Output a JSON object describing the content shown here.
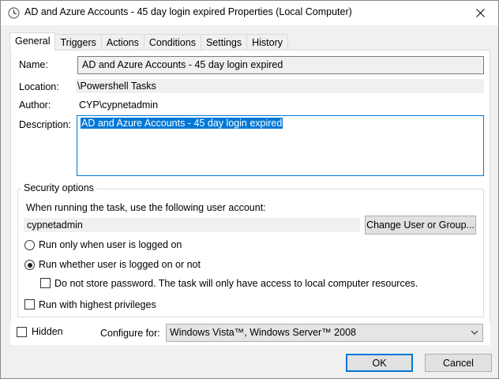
{
  "window": {
    "title": "AD and Azure Accounts - 45 day login expired Properties (Local Computer)"
  },
  "tabs": [
    {
      "label": "General"
    },
    {
      "label": "Triggers"
    },
    {
      "label": "Actions"
    },
    {
      "label": "Conditions"
    },
    {
      "label": "Settings"
    },
    {
      "label": "History"
    }
  ],
  "general": {
    "name_label": "Name:",
    "name_value": "AD and Azure Accounts - 45 day login expired",
    "location_label": "Location:",
    "location_value": "\\Powershell Tasks",
    "author_label": "Author:",
    "author_value": "CYP\\cypnetadmin",
    "description_label": "Description:",
    "description_value": "AD and Azure Accounts - 45 day login expired"
  },
  "security": {
    "group_title": "Security options",
    "account_prompt": "When running the task, use the following user account:",
    "account_value": "cypnetadmin",
    "change_button": "Change User or Group...",
    "radio_logged_on": "Run only when user is logged on",
    "radio_whether": "Run whether user is logged on or not",
    "no_store_password": "Do not store password.  The task will only have access to local computer resources.",
    "highest_privileges": "Run with highest privileges",
    "selected_option": "radio_whether"
  },
  "bottom": {
    "hidden_label": "Hidden",
    "configure_label": "Configure for:",
    "configure_value": "Windows Vista™, Windows Server™ 2008"
  },
  "buttons": {
    "ok": "OK",
    "cancel": "Cancel"
  },
  "colors": {
    "accent": "#0078d7",
    "window_bg": "#f0f0f0",
    "panel_bg": "#ffffff"
  }
}
